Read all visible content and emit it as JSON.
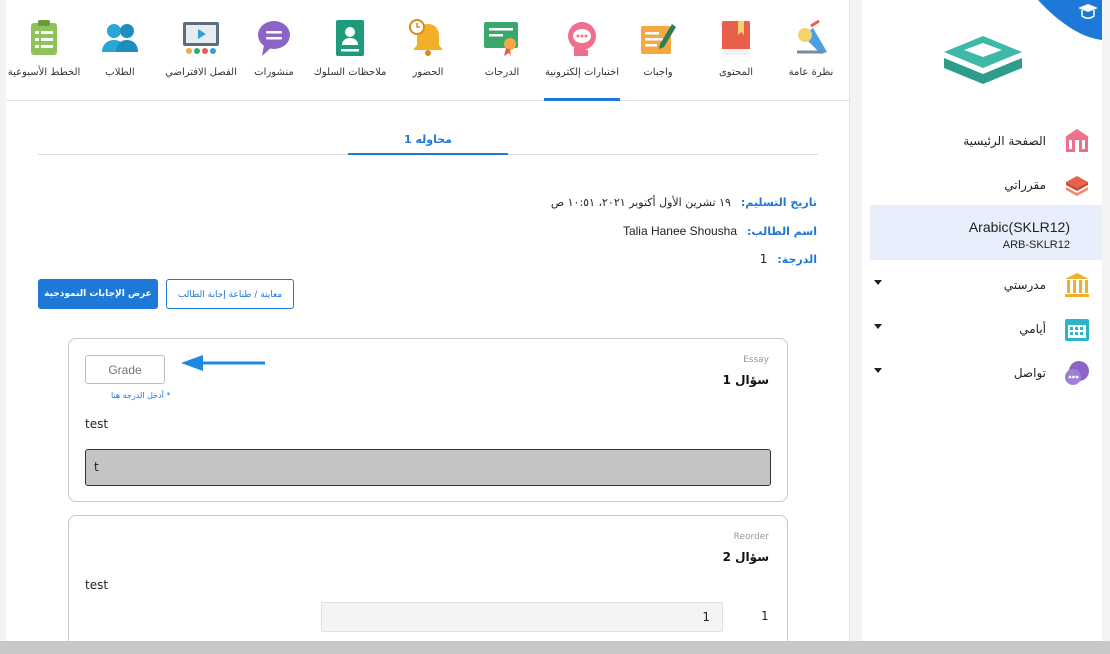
{
  "topnav": {
    "items": [
      {
        "id": "overview",
        "label": "نظرة عامة",
        "icon": "easel-lamp-icon",
        "color": "#4d9fe0"
      },
      {
        "id": "content",
        "label": "المحتوى",
        "icon": "book-icon",
        "color": "#e8604c"
      },
      {
        "id": "assignments",
        "label": "واجبات",
        "icon": "pencil-paper-icon",
        "color": "#f5a742"
      },
      {
        "id": "exams",
        "label": "اختبارات إلكترونية",
        "icon": "thinking-head-icon",
        "color": "#ef6f8c"
      },
      {
        "id": "grades",
        "label": "الدرجات",
        "icon": "certificate-icon",
        "color": "#3aa86c"
      },
      {
        "id": "attendance",
        "label": "الحضور",
        "icon": "bell-clock-icon",
        "color": "#f2b02a"
      },
      {
        "id": "behavior",
        "label": "ملاحظات السلوك",
        "icon": "id-badge-icon",
        "color": "#1e9b7a"
      },
      {
        "id": "posts",
        "label": "منشورات",
        "icon": "speech-bubble-icon",
        "color": "#8c64c6"
      },
      {
        "id": "virtual",
        "label": "الفصل الافتراضي",
        "icon": "presentation-screen-icon",
        "color": "#5b6e7e"
      },
      {
        "id": "students",
        "label": "الطلاب",
        "icon": "users-icon",
        "color": "#2aa5d8"
      },
      {
        "id": "weekly",
        "label": "الخطط الأسبوعية",
        "icon": "clipboard-checklist-icon",
        "color": "#8fc25a"
      }
    ],
    "active": "exams"
  },
  "attempt_tab": "محاوله 1",
  "submission": {
    "date_label": "تاريخ التسليم:",
    "date_value": "١٩ تشرين الأول أكتوبر ٢٠٢١، ١٠:٥١ ص",
    "student_label": "اسم الطالب:",
    "student_value": "Talia Hanee Shousha",
    "grade_label": "الدرجة:",
    "grade_value": "1"
  },
  "buttons": {
    "model_answers": "عرض الإجابات النموذجية",
    "preview_print": "معاينة / طباعة إجابة الطالب"
  },
  "question1": {
    "type": "Essay",
    "title": "سؤال 1",
    "grade_placeholder": "Grade",
    "grade_hint": "* أدخل الدرجة هنا",
    "text": "test",
    "answer": "t"
  },
  "question2": {
    "type": "Reorder",
    "title": "سؤال 2",
    "text": "test",
    "items": [
      {
        "index": "1",
        "value": "1"
      }
    ]
  },
  "sidebar": {
    "home": "الصفحة الرئيسية",
    "my_courses": "مقرراتي",
    "course_name": "Arabic(SKLR12)",
    "course_code": "ARB-SKLR12",
    "my_school": "مدرستي",
    "my_days": "أيامي",
    "communicate": "تواصل"
  },
  "colors": {
    "accent": "#1e78d7",
    "course_highlight": "#e8eefb"
  }
}
